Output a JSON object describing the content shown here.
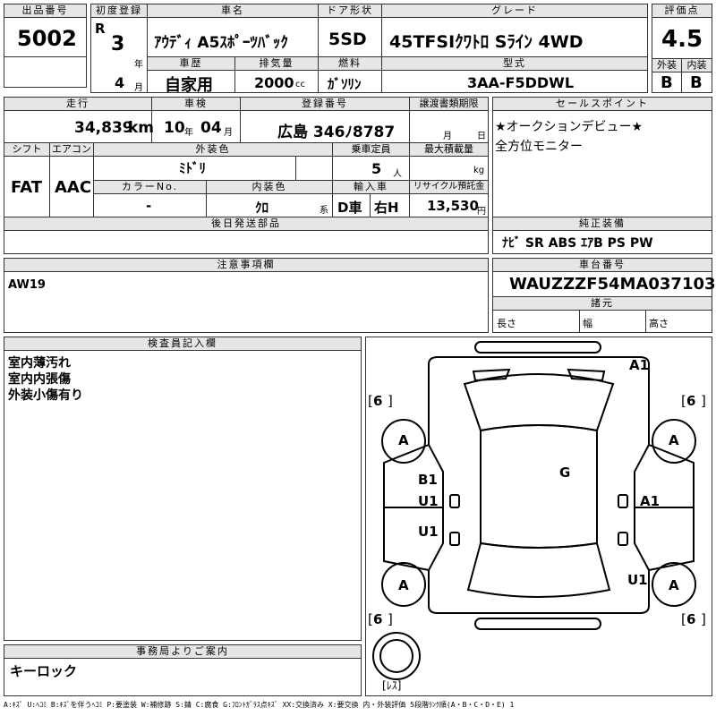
{
  "lot": {
    "label": "出品番号",
    "value": "5002"
  },
  "first_reg": {
    "label": "初度登録",
    "era": "R",
    "year": "3",
    "year_unit": "年",
    "month": "4",
    "month_unit": "月"
  },
  "car_name": {
    "label": "車名",
    "value": "ｱｳﾃﾞｨ A5ｽﾎﾟｰﾂﾊﾞｯｸ"
  },
  "door": {
    "label": "ドア形状",
    "value": "5SD"
  },
  "grade": {
    "label": "グレード",
    "value": "45TFSIｸﾜﾄﾛ Sﾗｲﾝ 4WD"
  },
  "score": {
    "label": "評価点",
    "value": "4.5",
    "ext_label": "外装",
    "int_label": "内装",
    "ext": "B",
    "int": "B"
  },
  "history": {
    "label": "車歴",
    "value": "自家用"
  },
  "displacement": {
    "label": "排気量",
    "value": "2000",
    "unit": "cc"
  },
  "fuel": {
    "label": "燃料",
    "value": "ｶﾞｿﾘﾝ"
  },
  "model_code": {
    "label": "型式",
    "value": "3AA-F5DDWL"
  },
  "mileage": {
    "label": "走行",
    "value": "34,839",
    "unit": "km"
  },
  "inspection": {
    "label": "車検",
    "year": "10",
    "year_unit": "年",
    "month": "04",
    "month_unit": "月"
  },
  "plate": {
    "label": "登録番号",
    "value": "広島 346ﾉ8787"
  },
  "transfer": {
    "label": "譲渡書類期限",
    "month_unit": "月",
    "day_unit": "日"
  },
  "sales_point": {
    "label": "セールスポイント",
    "lines": [
      "★オークションデビュー★",
      "全方位モニター"
    ]
  },
  "shift": {
    "label": "シフト",
    "value": "FAT"
  },
  "aircon": {
    "label": "エアコン",
    "value": "AAC"
  },
  "ext_color": {
    "label": "外装色",
    "value": "ﾐﾄﾞﾘ"
  },
  "capacity": {
    "label": "乗車定員",
    "value": "5",
    "unit": "人"
  },
  "max_load": {
    "label": "最大積載量",
    "unit": "kg"
  },
  "color_no": {
    "label": "カラーNo.",
    "value": "-"
  },
  "int_color": {
    "label": "内装色",
    "value": "ｸﾛ",
    "unit": "系"
  },
  "import": {
    "label": "輸入車",
    "value1": "D車",
    "value2": "右H"
  },
  "recycle": {
    "label": "リサイクル預託金",
    "value": "13,530",
    "unit": "円"
  },
  "later_parts": {
    "label": "後日発送部品"
  },
  "equipment": {
    "label": "純正装備",
    "value": "ﾅﾋﾞ SR ABS ｴｱB PS PW"
  },
  "notes": {
    "label": "注意事項欄",
    "value": "AW19"
  },
  "chassis": {
    "label": "車台番号",
    "value": "WAUZZZF54MA037103"
  },
  "dims": {
    "label": "諸元",
    "length": "長さ",
    "width": "幅",
    "height": "高さ"
  },
  "inspector": {
    "label": "検査員記入欄",
    "lines": [
      "室内薄汚れ",
      "室内内張傷",
      "外装小傷有り"
    ]
  },
  "office": {
    "label": "事務局よりご案内",
    "value": "キーロック"
  },
  "diagram": {
    "tires": "6",
    "wheel": "A",
    "marks": {
      "a1_top": "A1",
      "b1": "B1",
      "u1_a": "U1",
      "g": "G",
      "a1_side": "A1",
      "u1_b": "U1",
      "u1_c": "U1"
    },
    "spare_label": "ﾚｽ"
  },
  "legend": "A:ｷｽﾞ U:ﾍｺﾐ B:ｷｽﾞを伴うﾍｺﾐ P:要塗装 W:補修跡 S:錆 C:腐食 G:ﾌﾛﾝﾄｶﾞﾗｽ点ｷｽﾞ XX:交換済み X:要交換 内・外装評価 5段階ﾗﾝｸ順(A・B・C・D・E) 1"
}
